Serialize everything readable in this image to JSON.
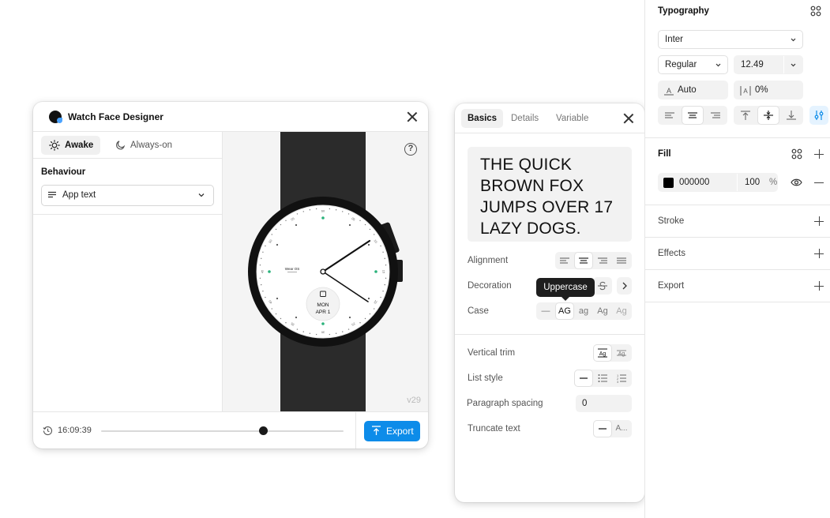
{
  "watch_face_designer": {
    "title": "Watch Face Designer",
    "modes": [
      "Awake",
      "Always-on"
    ],
    "behaviour_label": "Behaviour",
    "behaviour_value": "App text",
    "help_symbol": "?",
    "version": "v29",
    "time": "16:09:39",
    "timeline_progress": 0.67,
    "export_label": "Export",
    "watch": {
      "app_name": "Wear OS",
      "date_day": "MON",
      "date": "APR 1",
      "dial_numbers": [
        "60",
        "05",
        "10",
        "15",
        "20",
        "25",
        "30",
        "35",
        "40",
        "45",
        "50",
        "55"
      ],
      "band_color": "#2b2b2b",
      "accent_color": "#2ab27b"
    }
  },
  "text_panel": {
    "tabs": [
      "Basics",
      "Details",
      "Variable"
    ],
    "sample_text": "THE QUICK BROWN FOX JUMPS OVER 17 LAZY DOGS.",
    "alignment_label": "Alignment",
    "decoration_label": "Decoration",
    "case_label": "Case",
    "case_options": [
      "—",
      "AG",
      "ag",
      "Ag",
      "Ag"
    ],
    "tooltip": "Uppercase",
    "vertical_trim_label": "Vertical trim",
    "list_style_label": "List style",
    "paragraph_spacing_label": "Paragraph spacing",
    "paragraph_spacing_value": "0",
    "truncate_label": "Truncate text",
    "truncate_option": "A..."
  },
  "properties": {
    "typography_title": "Typography",
    "font_family": "Inter",
    "font_weight": "Regular",
    "font_size": "12.49",
    "line_height": "Auto",
    "letter_spacing": "0%",
    "fill_title": "Fill",
    "fill_hex": "000000",
    "fill_opacity": "100",
    "fill_percent": "%",
    "fill_color": "#000000",
    "stroke_title": "Stroke",
    "effects_title": "Effects",
    "export_title": "Export"
  }
}
